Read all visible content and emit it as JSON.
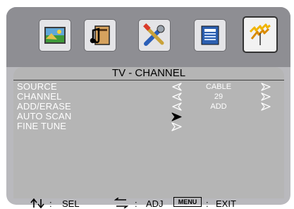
{
  "tabs": [
    {
      "icon": "picture-icon"
    },
    {
      "icon": "sound-icon"
    },
    {
      "icon": "setup-tools-icon"
    },
    {
      "icon": "features-list-icon"
    },
    {
      "icon": "antenna-channel-icon"
    }
  ],
  "panel": {
    "title": "TV - CHANNEL"
  },
  "menu": [
    {
      "label": "SOURCE",
      "value": "CABLE"
    },
    {
      "label": "CHANNEL",
      "value": "29"
    },
    {
      "label": "ADD/ERASE",
      "value": "ADD"
    },
    {
      "label": "AUTO SCAN",
      "value": ""
    },
    {
      "label": "FINE TUNE",
      "value": ""
    }
  ],
  "footer": {
    "sel_label": "SEL",
    "adj_label": "ADJ",
    "menu_key": "MENU",
    "exit_label": "EXIT",
    "separator": ":"
  },
  "colors": {
    "frame": "#b9b9bd",
    "topbar": "#8e8e93",
    "panel": "#b5b5b5",
    "text": "#ffffff"
  }
}
